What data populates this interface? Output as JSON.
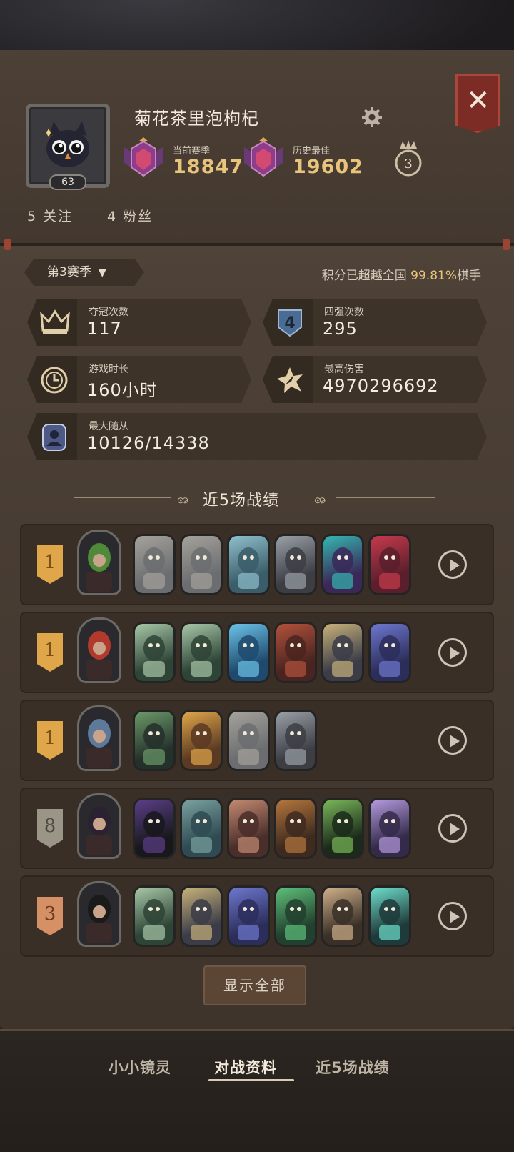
{
  "profile": {
    "username": "菊花茶里泡枸杞",
    "level": "63",
    "current_season_label": "当前赛季",
    "current_season_score": "18847",
    "best_label": "历史最佳",
    "best_score": "19602",
    "crown_count": "3",
    "following": "5 关注",
    "followers": "4 粉丝"
  },
  "season": {
    "selector": "第3赛季",
    "percent_prefix": "积分已超越全国 ",
    "percent_value": "99.81%",
    "percent_suffix": "棋手"
  },
  "stats": {
    "champion_label": "夺冠次数",
    "champion_value": "117",
    "top4_label": "四强次数",
    "top4_value": "295",
    "playtime_label": "游戏时长",
    "playtime_value": "160小时",
    "damage_label": "最高伤害",
    "damage_value": "4970296692",
    "followers_label": "最大随从",
    "followers_value": "10126/14338"
  },
  "recent": {
    "title": "近5场战绩",
    "matches": [
      {
        "placement": "1",
        "tier": "gold",
        "hero": "green-haired-villain",
        "units": [
          "missile-unit",
          "missile-unit",
          "robot-rabbit",
          "mech-tower",
          "serpent",
          "red-jester"
        ]
      },
      {
        "placement": "1",
        "tier": "gold",
        "hero": "red-haired-witch",
        "units": [
          "goat-beast",
          "goat-beast",
          "ice-spider",
          "demon-beast",
          "dwarf-king",
          "blue-sorceress"
        ]
      },
      {
        "placement": "1",
        "tier": "gold",
        "hero": "top-hat-goblin",
        "units": [
          "goblin-mask",
          "pinocchio",
          "missile-unit",
          "mech-tower"
        ]
      },
      {
        "placement": "8",
        "tier": "gray",
        "hero": "dark-haired-girl",
        "units": [
          "hooded-shade",
          "zombie-brute",
          "fox-rogue",
          "reindeer",
          "skull-wraith",
          "purple-mage"
        ]
      },
      {
        "placement": "3",
        "tier": "bronze",
        "hero": "shadow-knight",
        "units": [
          "goat-beast",
          "dwarf-king",
          "blue-sorceress",
          "green-elf",
          "old-monk",
          "jade-warrior"
        ]
      }
    ],
    "show_all": "显示全部"
  },
  "tabs": {
    "items": [
      "小小镜灵",
      "对战资料",
      "近5场战绩"
    ],
    "active": "对战资料"
  },
  "colors": {
    "gold": "#e0a64a",
    "accent_score": "#e9c57b",
    "close_red": "#7c2c24"
  }
}
